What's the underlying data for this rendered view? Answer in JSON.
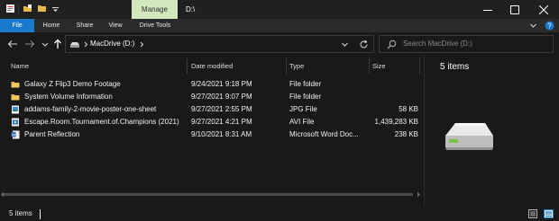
{
  "window": {
    "manage_tab": "Manage",
    "title": "D:\\",
    "icons": [
      "properties-icon",
      "new-folder-icon",
      "folder-icon"
    ]
  },
  "ribbon": {
    "tabs": [
      {
        "label": "File"
      },
      {
        "label": "Home"
      },
      {
        "label": "Share"
      },
      {
        "label": "View"
      },
      {
        "label": "Drive Tools"
      }
    ]
  },
  "address": {
    "path_label": "MacDrive (D:)",
    "search_placeholder": "Search MacDrive (D:)"
  },
  "columns": {
    "name": "Name",
    "date": "Date modified",
    "type": "Type",
    "size": "Size"
  },
  "files": [
    {
      "name": "Galaxy Z Flip3 Demo Footage",
      "date": "9/24/2021 9:18 PM",
      "type": "File folder",
      "size": "",
      "icon": "folder-icon"
    },
    {
      "name": "System Volume Information",
      "date": "9/27/2021 9:07 PM",
      "type": "File folder",
      "size": "",
      "icon": "folder-icon"
    },
    {
      "name": "addams-family-2-movie-poster-one-sheet",
      "date": "9/27/2021 2:55 PM",
      "type": "JPG File",
      "size": "58 KB",
      "icon": "image-file-icon"
    },
    {
      "name": "Escape.Room.Tournament.of.Champions (2021)",
      "date": "9/27/2021 4:21 PM",
      "type": "AVI File",
      "size": "1,439,283 KB",
      "icon": "video-file-icon"
    },
    {
      "name": "Parent Reflection",
      "date": "9/10/2021 8:31 AM",
      "type": "Microsoft Word Doc...",
      "size": "238 KB",
      "icon": "word-document-icon"
    }
  ],
  "details": {
    "item_count": "5 items"
  },
  "status": {
    "text": "5 items"
  },
  "colors": {
    "file_tab": "#1979ca",
    "manage_tab": "#d3e9bd",
    "folder": "#e8b84a",
    "background": "#191919"
  }
}
